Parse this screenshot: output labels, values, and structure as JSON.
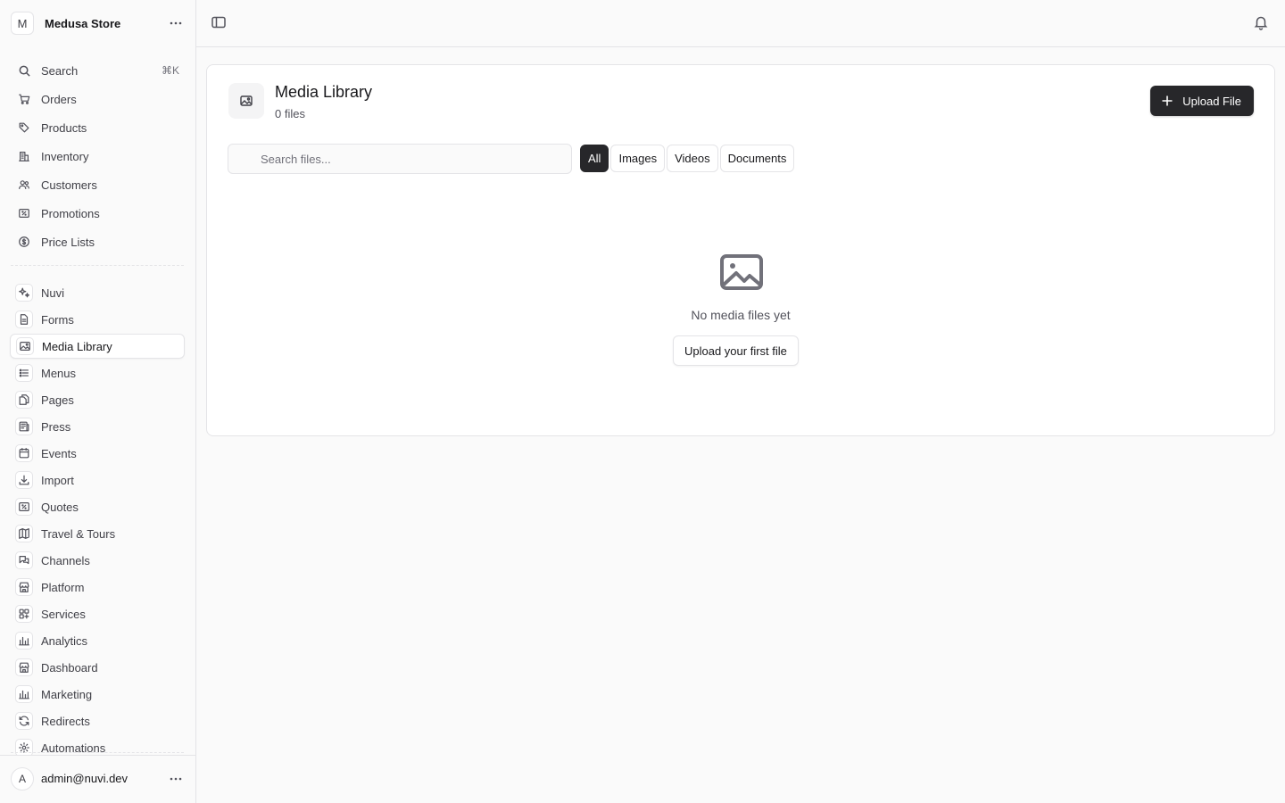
{
  "store": {
    "initial": "M",
    "name": "Medusa Store"
  },
  "search": {
    "label": "Search",
    "shortcut": "⌘K"
  },
  "nav_primary": [
    {
      "label": "Orders",
      "icon": "shopping-cart-icon"
    },
    {
      "label": "Products",
      "icon": "tag-icon"
    },
    {
      "label": "Inventory",
      "icon": "building-icon"
    },
    {
      "label": "Customers",
      "icon": "users-icon"
    },
    {
      "label": "Promotions",
      "icon": "receipt-percent-icon"
    },
    {
      "label": "Price Lists",
      "icon": "currency-dollar-icon"
    }
  ],
  "nav_extensions": [
    {
      "label": "Nuvi",
      "icon": "sparkles-icon"
    },
    {
      "label": "Forms",
      "icon": "document-text-icon"
    },
    {
      "label": "Media Library",
      "icon": "photo-icon",
      "active": true
    },
    {
      "label": "Menus",
      "icon": "list-bullet-icon"
    },
    {
      "label": "Pages",
      "icon": "document-duplicate-icon"
    },
    {
      "label": "Press",
      "icon": "newspaper-icon"
    },
    {
      "label": "Events",
      "icon": "calendar-icon"
    },
    {
      "label": "Import",
      "icon": "arrow-down-tray-icon"
    },
    {
      "label": "Quotes",
      "icon": "receipt-percent-icon"
    },
    {
      "label": "Travel & Tours",
      "icon": "map-icon"
    },
    {
      "label": "Channels",
      "icon": "chat-bubbles-icon"
    },
    {
      "label": "Platform",
      "icon": "building-storefront-icon"
    },
    {
      "label": "Services",
      "icon": "squares-plus-icon"
    },
    {
      "label": "Analytics",
      "icon": "chart-bar-icon"
    },
    {
      "label": "Dashboard",
      "icon": "building-storefront-icon"
    },
    {
      "label": "Marketing",
      "icon": "chart-bar-icon"
    },
    {
      "label": "Redirects",
      "icon": "arrow-path-icon"
    },
    {
      "label": "Automations",
      "icon": "cog-icon"
    }
  ],
  "user": {
    "initial": "A",
    "email": "admin@nuvi.dev"
  },
  "page": {
    "title": "Media Library",
    "file_count": "0 files",
    "upload_label": "Upload File",
    "search_placeholder": "Search files...",
    "filters": [
      {
        "label": "All",
        "active": true
      },
      {
        "label": "Images"
      },
      {
        "label": "Videos"
      },
      {
        "label": "Documents"
      }
    ],
    "empty_text": "No media files yet",
    "empty_button": "Upload your first file"
  }
}
